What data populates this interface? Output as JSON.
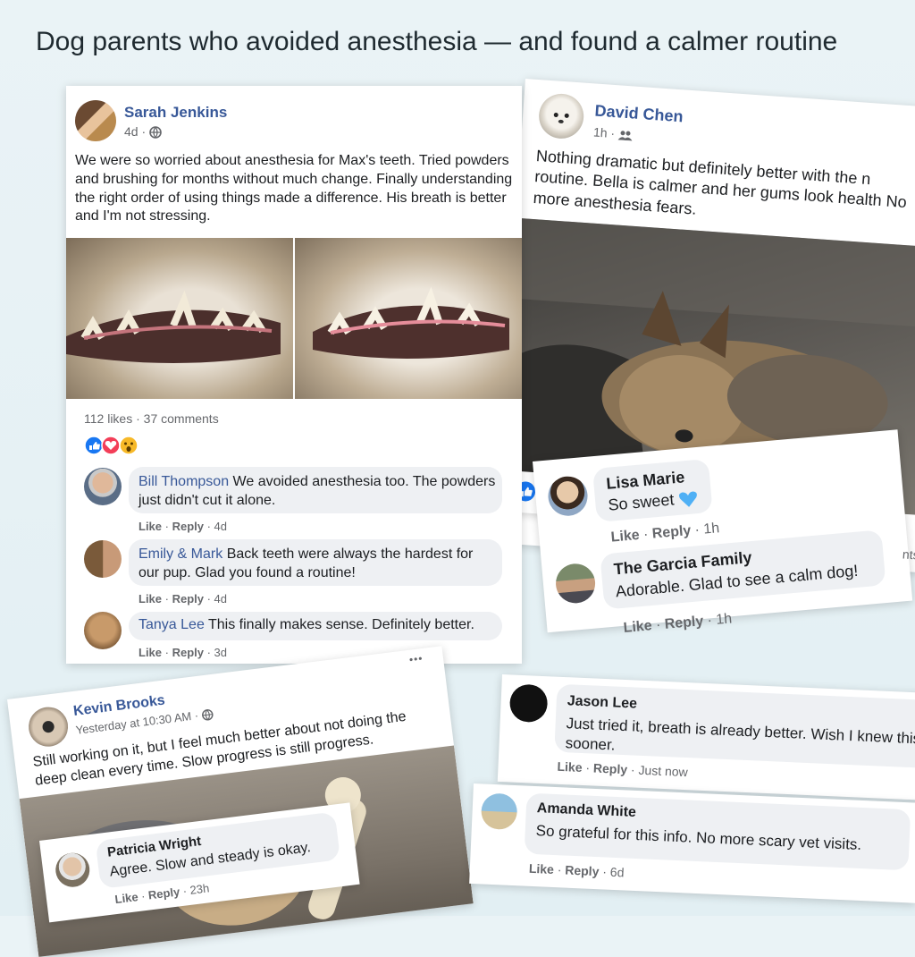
{
  "headline": "Dog parents who avoided anesthesia — and found a calmer routine",
  "post1": {
    "author": "Sarah Jenkins",
    "time": "4d",
    "body": "We were so worried about anesthesia for Max's teeth. Tried powders and brushing for months without much change. Finally understanding the right order of using things made a difference. His breath is better and I'm not stressing.",
    "stats": "112 likes · 37 comments",
    "comments": [
      {
        "name": "Bill Thompson",
        "text": "We avoided anesthesia too. The powders just didn't cut it alone.",
        "like": "Like",
        "reply": "Reply",
        "time": "4d"
      },
      {
        "name": "Emily & Mark",
        "text": "Back teeth were always the hardest for our pup. Glad you found a routine!",
        "like": "Like",
        "reply": "Reply",
        "time": "4d"
      },
      {
        "name": "Tanya Lee",
        "text": "This finally makes sense. Definitely better.",
        "like": "Like",
        "reply": "Reply",
        "time": "3d"
      }
    ]
  },
  "post2": {
    "author": "David Chen",
    "time": "1h",
    "body": "Nothing dramatic but definitely better with the n routine. Bella is calmer and her gums look health No more anesthesia fears.",
    "partial": "nts",
    "comments": [
      {
        "name": "Lisa Marie",
        "text": "So sweet",
        "like": "Like",
        "reply": "Reply",
        "time": "1h"
      },
      {
        "name": "The Garcia Family",
        "text": "Adorable. Glad to see a calm dog!",
        "like": "Like",
        "reply": "Reply",
        "time": "1h"
      }
    ]
  },
  "post3": {
    "author": "Kevin Brooks",
    "time": "Yesterday at 10:30 AM",
    "body": "Still working on it, but I feel much better about not doing the deep clean every time. Slow progress is still progress.",
    "more": "•••",
    "comment": {
      "name": "Patricia Wright",
      "text": "Agree. Slow and steady is okay.",
      "like": "Like",
      "reply": "Reply",
      "time": "23h"
    }
  },
  "comment_jason": {
    "name": "Jason Lee",
    "text": "Just tried it, breath is already better. Wish I knew this sooner.",
    "like": "Like",
    "reply": "Reply",
    "time": "Just now"
  },
  "comment_amanda": {
    "name": "Amanda White",
    "text": "So grateful for this info. No more scary vet visits.",
    "like": "Like",
    "reply": "Reply",
    "time": "6d"
  },
  "colors": {
    "link": "#385898",
    "meta": "#65676b",
    "bubble": "#eef0f3",
    "heart_emoji": "#4fb0f5",
    "like_blue": "#1877f2",
    "love_red": "#f33e58",
    "wow_yellow": "#f7b928"
  }
}
